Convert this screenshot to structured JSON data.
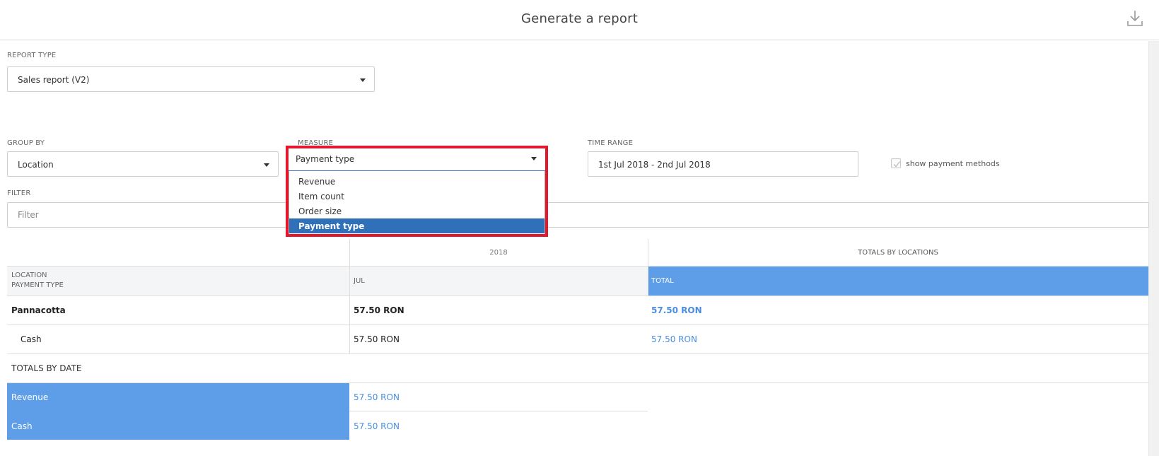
{
  "header": {
    "title": "Generate a report",
    "download_icon": "download-icon"
  },
  "report_type": {
    "label": "REPORT TYPE",
    "value": "Sales report (V2)"
  },
  "group_by": {
    "label": "GROUP BY",
    "value": "Location"
  },
  "measure": {
    "label": "MEASURE",
    "value": "Payment type",
    "options": [
      "Revenue",
      "Item count",
      "Order size",
      "Payment type"
    ],
    "selected_index": 3
  },
  "time_range": {
    "label": "TIME RANGE",
    "value": "1st Jul  2018 - 2nd Jul  2018"
  },
  "show_payment_methods": {
    "label": "show payment methods",
    "checked": true
  },
  "filter": {
    "label": "FILTER",
    "placeholder": "Filter"
  },
  "table": {
    "year_header": "2018",
    "totals_by_locations_header": "TOTALS BY LOCATIONS",
    "row_header_line1": "LOCATION",
    "row_header_line2": "PAYMENT TYPE",
    "month_header": "JUL",
    "total_header": "TOTAL",
    "rows": [
      {
        "name": "Pannacotta",
        "jul": "57.50 RON",
        "total": "57.50 RON",
        "bold": true
      },
      {
        "name": "Cash",
        "jul": "57.50 RON",
        "total": "57.50 RON",
        "bold": false
      }
    ],
    "totals_by_date_label": "TOTALS BY DATE",
    "totals_by_date": [
      {
        "name": "Revenue",
        "value": "57.50 RON"
      },
      {
        "name": "Cash",
        "value": "57.50 RON"
      }
    ]
  },
  "colors": {
    "accent_blue": "#5e9de8",
    "selected_blue": "#2f70b8",
    "highlight_red": "#e3182d"
  }
}
